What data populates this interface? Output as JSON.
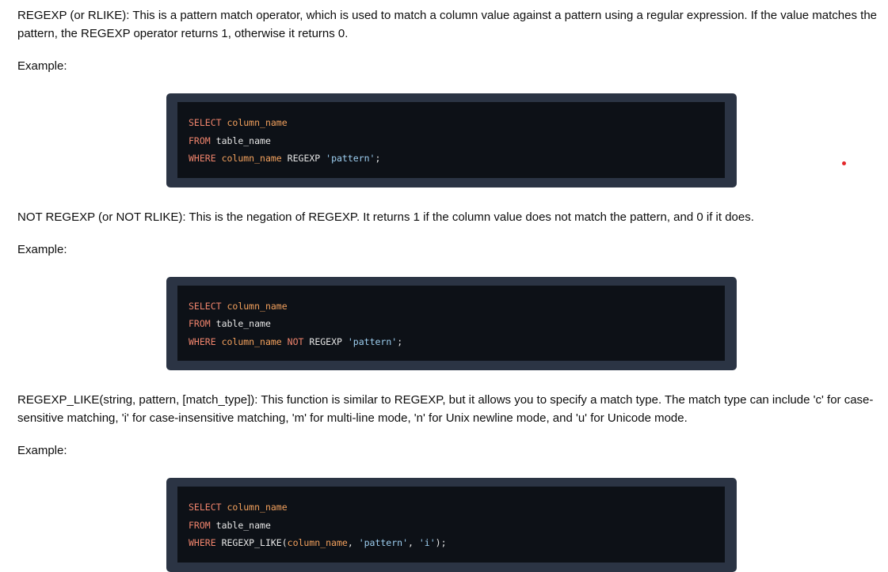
{
  "sections": [
    {
      "description": "REGEXP (or RLIKE): This is a pattern match operator, which is used to match a column value against a pattern using a regular expression. If the value matches the pattern, the REGEXP operator returns 1, otherwise it returns 0.",
      "example_label": "Example:",
      "code": {
        "line1": {
          "kw": "SELECT",
          "rest": "column_name"
        },
        "line2": {
          "kw": "FROM",
          "rest": "table_name"
        },
        "line3": {
          "kw": "WHERE",
          "col": "column_name",
          "op": "REGEXP",
          "str": "'pattern'",
          "end": ";"
        }
      }
    },
    {
      "description": "NOT REGEXP (or NOT RLIKE): This is the negation of REGEXP. It returns 1 if the column value does not match the pattern, and 0 if it does.",
      "example_label": "Example:",
      "code": {
        "line1": {
          "kw": "SELECT",
          "rest": "column_name"
        },
        "line2": {
          "kw": "FROM",
          "rest": "table_name"
        },
        "line3": {
          "kw": "WHERE",
          "col": "column_name",
          "not": "NOT",
          "op": "REGEXP",
          "str": "'pattern'",
          "end": ";"
        }
      }
    },
    {
      "description": "REGEXP_LIKE(string, pattern, [match_type]): This function is similar to REGEXP, but it allows you to specify a match type. The match type can include 'c' for case-sensitive matching, 'i' for case-insensitive matching, 'm' for multi-line mode, 'n' for Unix newline mode, and 'u' for Unicode mode.",
      "example_label": "Example:",
      "code": {
        "line1": {
          "kw": "SELECT",
          "rest": "column_name"
        },
        "line2": {
          "kw": "FROM",
          "rest": "table_name"
        },
        "line3": {
          "kw": "WHERE",
          "fn": "REGEXP_LIKE(",
          "col": "column_name",
          "sep1": ", ",
          "str1": "'pattern'",
          "sep2": ", ",
          "str2": "'i'",
          "end": ");"
        }
      }
    }
  ],
  "colors": {
    "keyword": "#f0846c",
    "identifier": "#f3a15d",
    "string": "#9ed0f2",
    "code_bg": "#0d1117",
    "code_frame": "#2b3444",
    "marker_dot": "#e3262a"
  }
}
